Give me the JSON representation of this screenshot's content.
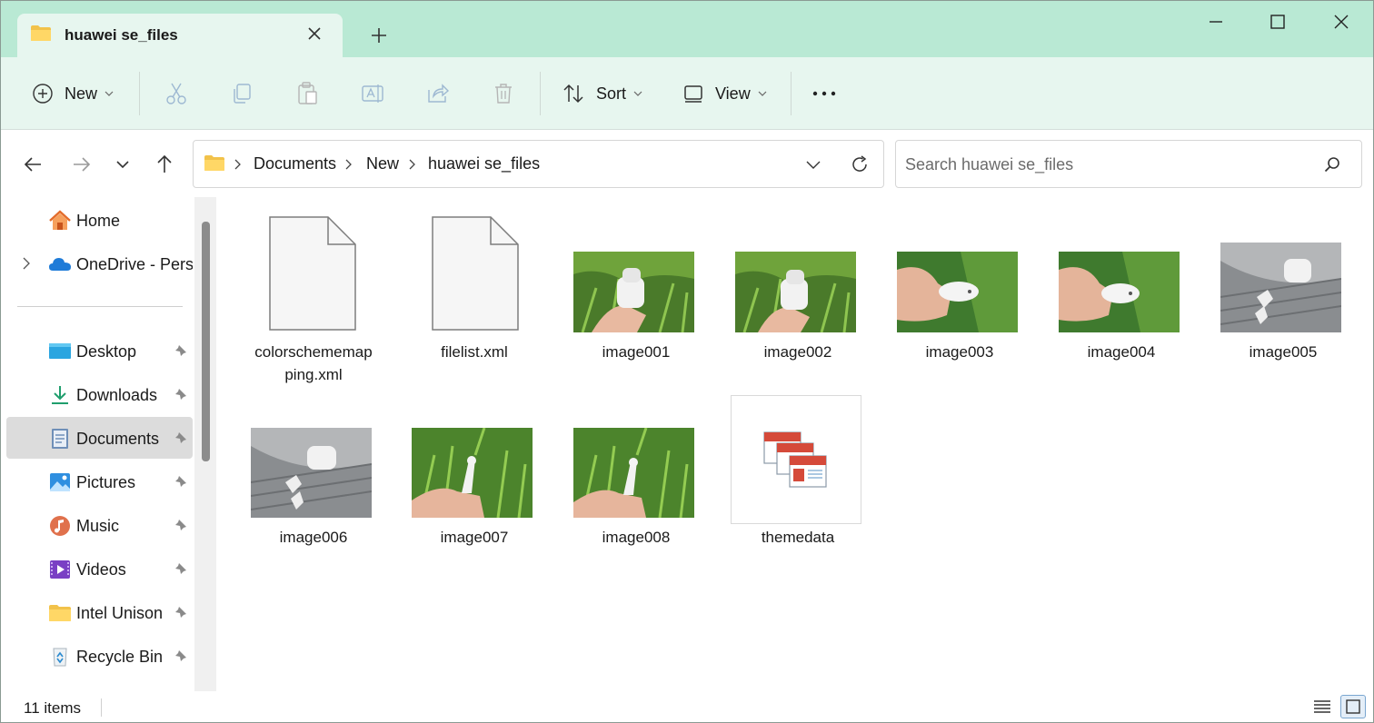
{
  "tab": {
    "title": "huawei se_files"
  },
  "toolbar": {
    "new_label": "New",
    "sort_label": "Sort",
    "view_label": "View"
  },
  "address": {
    "crumbs": [
      "Documents",
      "New",
      "huawei se_files"
    ]
  },
  "search": {
    "placeholder": "Search huawei se_files"
  },
  "sidebar": {
    "items": [
      {
        "label": "Home"
      },
      {
        "label": "OneDrive - Personal"
      },
      {
        "label": "Desktop"
      },
      {
        "label": "Downloads"
      },
      {
        "label": "Documents"
      },
      {
        "label": "Pictures"
      },
      {
        "label": "Music"
      },
      {
        "label": "Videos"
      },
      {
        "label": "Intel Unison"
      },
      {
        "label": "Recycle Bin"
      }
    ]
  },
  "files": [
    {
      "name": "colorschememapping.xml",
      "display": "colorschememap\nping.xml",
      "type": "xml"
    },
    {
      "name": "filelist.xml",
      "type": "xml"
    },
    {
      "name": "image001",
      "type": "image"
    },
    {
      "name": "image002",
      "type": "image"
    },
    {
      "name": "image003",
      "type": "image"
    },
    {
      "name": "image004",
      "type": "image"
    },
    {
      "name": "image005",
      "type": "image"
    },
    {
      "name": "image006",
      "type": "image"
    },
    {
      "name": "image007",
      "type": "image"
    },
    {
      "name": "image008",
      "type": "image"
    },
    {
      "name": "themedata",
      "type": "theme"
    }
  ],
  "status": {
    "count": "11 items"
  },
  "colors": {
    "titlebar": "#b9e9d4",
    "toolbar": "#e7f6ef",
    "selected": "#dcdcdc"
  }
}
